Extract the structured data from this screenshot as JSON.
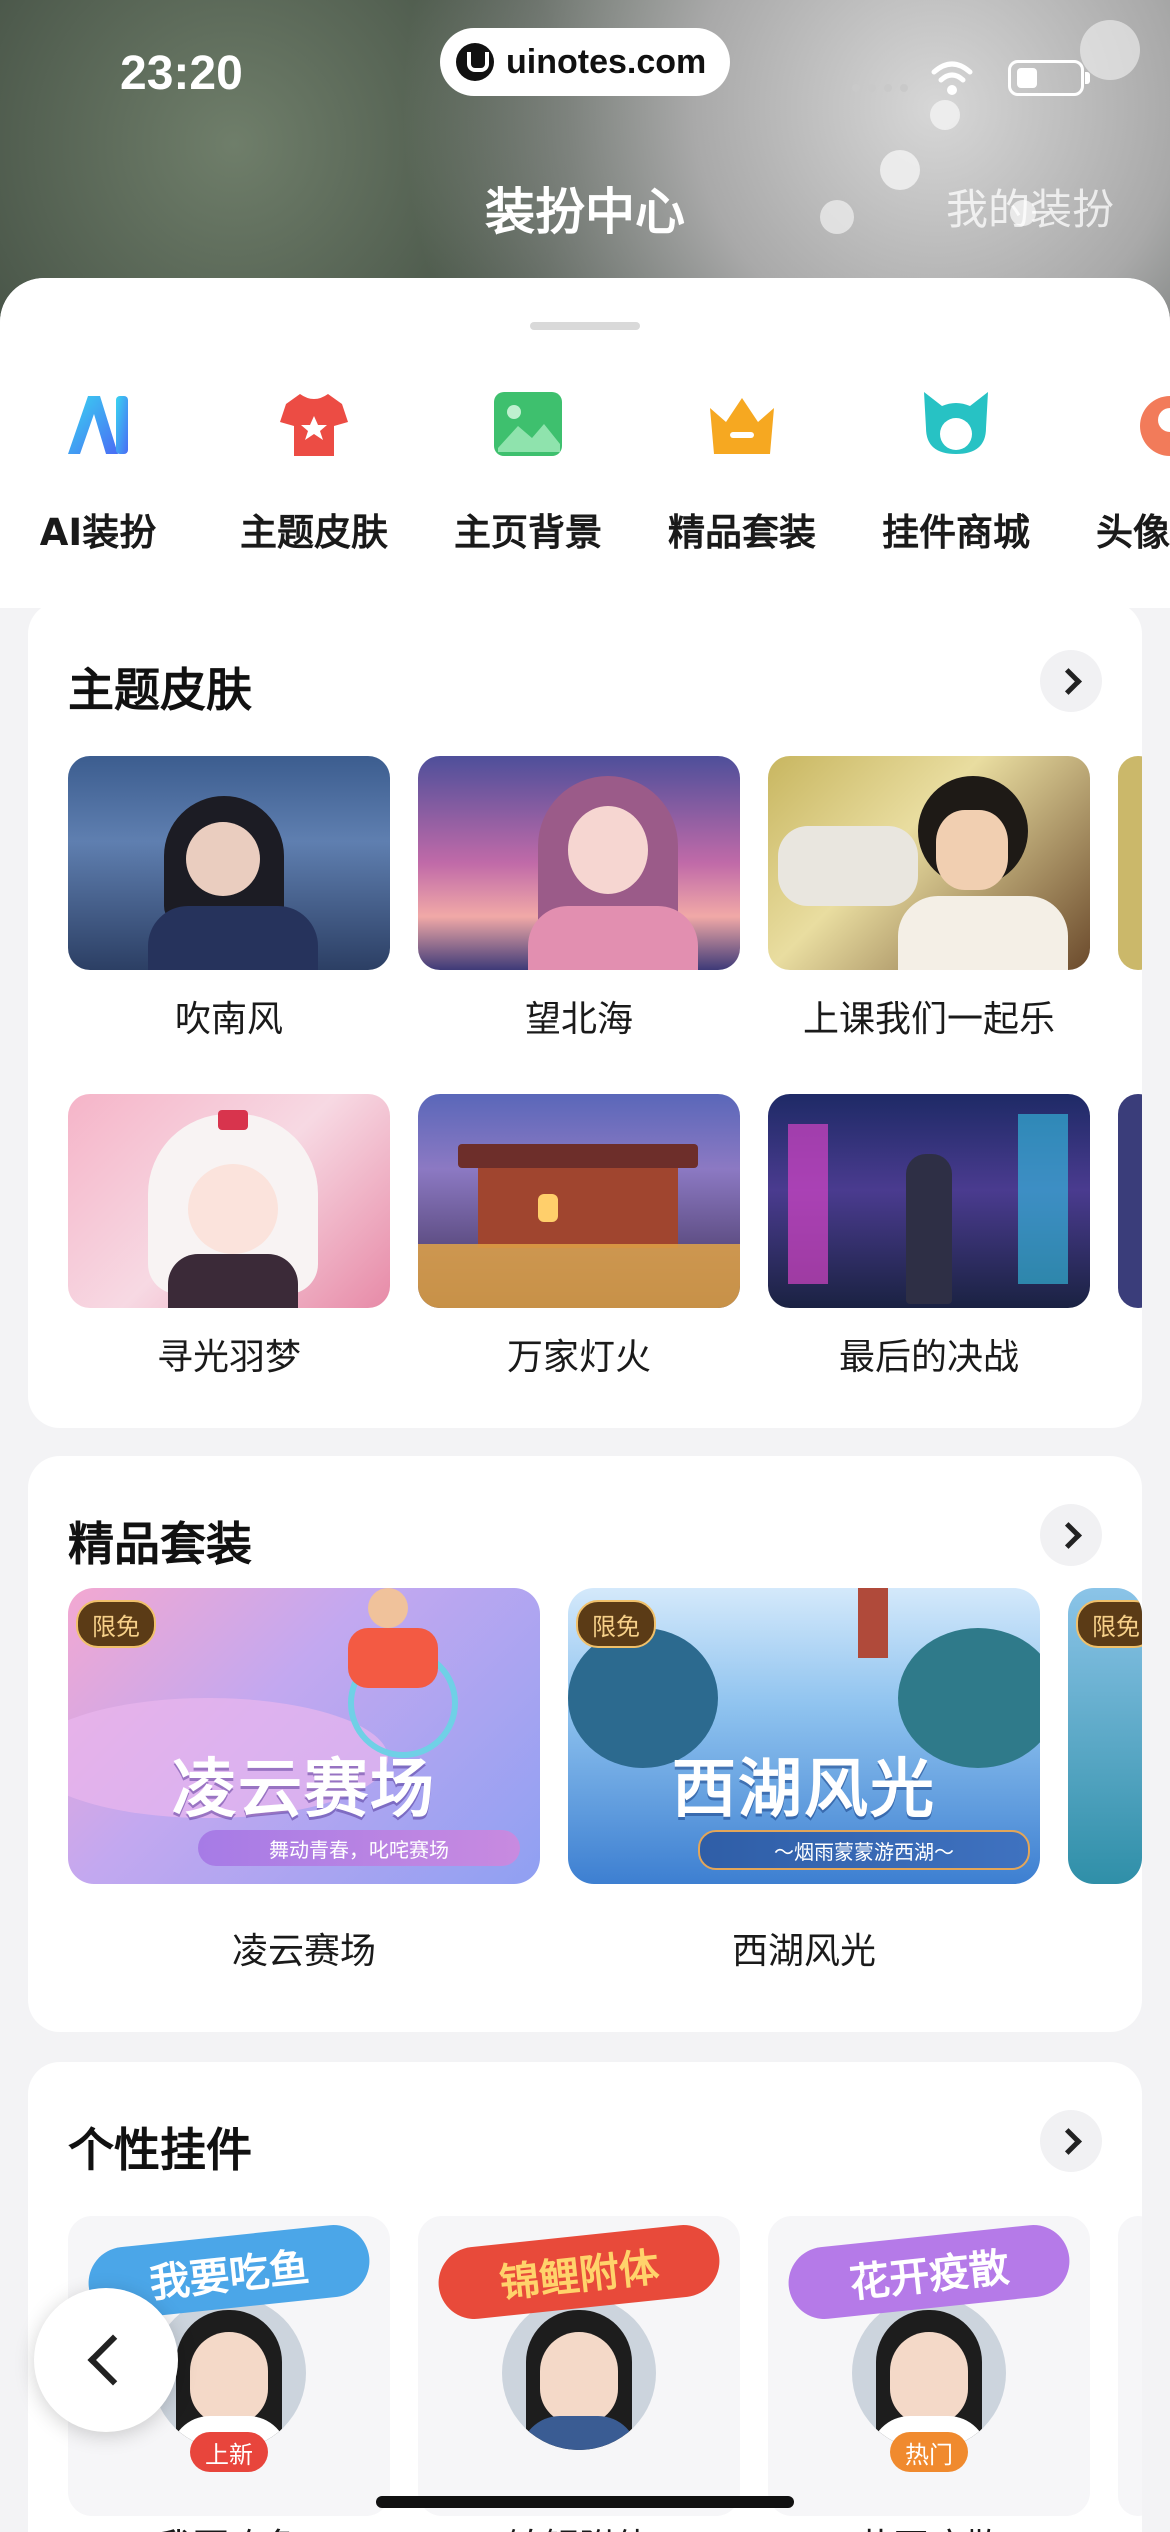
{
  "status": {
    "time": "23:20",
    "url": "uinotes.com"
  },
  "header": {
    "title": "装扮中心",
    "my_dress": "我的装扮"
  },
  "categories": [
    {
      "label": "AI装扮",
      "icon": "ai-icon"
    },
    {
      "label": "主题皮肤",
      "icon": "tshirt-icon"
    },
    {
      "label": "主页背景",
      "icon": "image-icon"
    },
    {
      "label": "精品套装",
      "icon": "crown-icon"
    },
    {
      "label": "挂件商城",
      "icon": "pendant-icon"
    },
    {
      "label": "头像",
      "icon": "avatar-icon"
    }
  ],
  "skins": {
    "title": "主题皮肤",
    "items": [
      {
        "label": "吹南风"
      },
      {
        "label": "望北海"
      },
      {
        "label": "上课我们一起乐"
      },
      {
        "label": "寻光羽梦"
      },
      {
        "label": "万家灯火"
      },
      {
        "label": "最后的决战"
      }
    ]
  },
  "suites": {
    "title": "精品套装",
    "items": [
      {
        "label": "凌云赛场",
        "badge": "限免",
        "banner": "凌云赛场",
        "subtitle": "舞动青春，叱咤赛场"
      },
      {
        "label": "西湖风光",
        "badge": "限免",
        "banner": "西湖风光",
        "subtitle": "～烟雨蒙蒙游西湖～"
      },
      {
        "badge": "限免"
      }
    ]
  },
  "pendants": {
    "title": "个性挂件",
    "items": [
      {
        "label": "我要吃鱼",
        "banner": "我要吃鱼",
        "tag": "上新"
      },
      {
        "label": "锦鲤附体",
        "banner": "锦鲤附体"
      },
      {
        "label": "花开疫散",
        "banner": "花开疫散",
        "tag": "热门"
      }
    ]
  },
  "colors": {
    "accent_red": "#e8453c",
    "tag_orange": "#f08a2e",
    "badge_brown": "#5b3b16"
  }
}
